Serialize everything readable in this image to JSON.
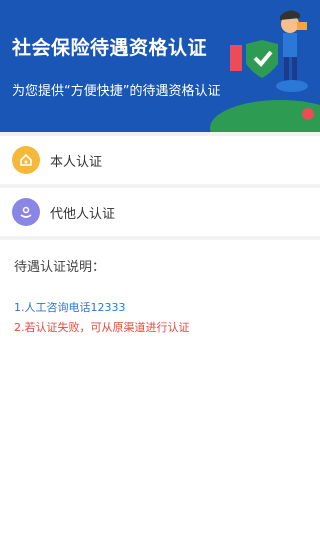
{
  "header": {
    "title": "社会保险待遇资格认证",
    "subtitle": "为您提供“方便快捷”的待遇资格认证"
  },
  "menu": {
    "items": [
      {
        "label": "本人认证",
        "icon": "home-icon",
        "color": "#f6b83a"
      },
      {
        "label": "代他人认证",
        "icon": "hand-icon",
        "color": "#8a86e6"
      }
    ]
  },
  "info": {
    "heading": "待遇认证说明：",
    "line1": "1.人工咨询电话12333",
    "line2": "2.若认证失败，可从原渠道进行认证",
    "line1_color": "#2b78d6",
    "line2_color": "#e8483b"
  },
  "colors": {
    "banner": "#1a56b6"
  }
}
